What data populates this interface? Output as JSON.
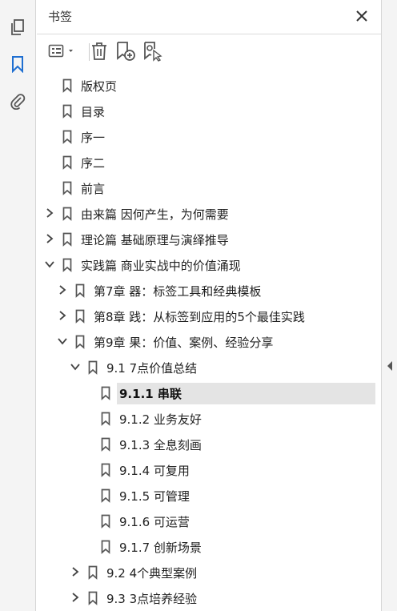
{
  "panel": {
    "title": "书签"
  },
  "colors": {
    "accent": "#1f6fd1",
    "icon": "#555555",
    "selected_bg": "#e4e4e4"
  },
  "leftbar": {
    "items": [
      {
        "name": "pages-icon"
      },
      {
        "name": "bookmark-icon",
        "active": true
      },
      {
        "name": "attachment-icon"
      }
    ]
  },
  "toolbar": {
    "items": [
      "options-menu-icon",
      "delete-icon",
      "new-bookmark-icon",
      "bookmark-search-icon"
    ]
  },
  "bookmarks": [
    {
      "label": "版权页",
      "level": 0,
      "expander": "none"
    },
    {
      "label": "目录",
      "level": 0,
      "expander": "none"
    },
    {
      "label": "序一",
      "level": 0,
      "expander": "none"
    },
    {
      "label": "序二",
      "level": 0,
      "expander": "none"
    },
    {
      "label": "前言",
      "level": 0,
      "expander": "none"
    },
    {
      "label": "由来篇 因何产生，为何需要",
      "level": 0,
      "expander": "collapsed"
    },
    {
      "label": "理论篇 基础原理与演绎推导",
      "level": 0,
      "expander": "collapsed"
    },
    {
      "label": "实践篇 商业实战中的价值涌现",
      "level": 0,
      "expander": "expanded"
    },
    {
      "label": "第7章 器：标签工具和经典模板",
      "level": 1,
      "expander": "collapsed"
    },
    {
      "label": "第8章 践：从标签到应用的5个最佳实践",
      "level": 1,
      "expander": "collapsed"
    },
    {
      "label": "第9章 果：价值、案例、经验分享",
      "level": 1,
      "expander": "expanded"
    },
    {
      "label": "9.1 7点价值总结",
      "level": 2,
      "expander": "expanded"
    },
    {
      "label": "9.1.1 串联",
      "level": 3,
      "expander": "none",
      "selected": true
    },
    {
      "label": "9.1.2 业务友好",
      "level": 3,
      "expander": "none"
    },
    {
      "label": "9.1.3 全息刻画",
      "level": 3,
      "expander": "none"
    },
    {
      "label": "9.1.4 可复用",
      "level": 3,
      "expander": "none"
    },
    {
      "label": "9.1.5 可管理",
      "level": 3,
      "expander": "none"
    },
    {
      "label": "9.1.6 可运营",
      "level": 3,
      "expander": "none"
    },
    {
      "label": "9.1.7 创新场景",
      "level": 3,
      "expander": "none"
    },
    {
      "label": "9.2 4个典型案例",
      "level": 2,
      "expander": "collapsed"
    },
    {
      "label": "9.3 3点培养经验",
      "level": 2,
      "expander": "collapsed"
    }
  ]
}
